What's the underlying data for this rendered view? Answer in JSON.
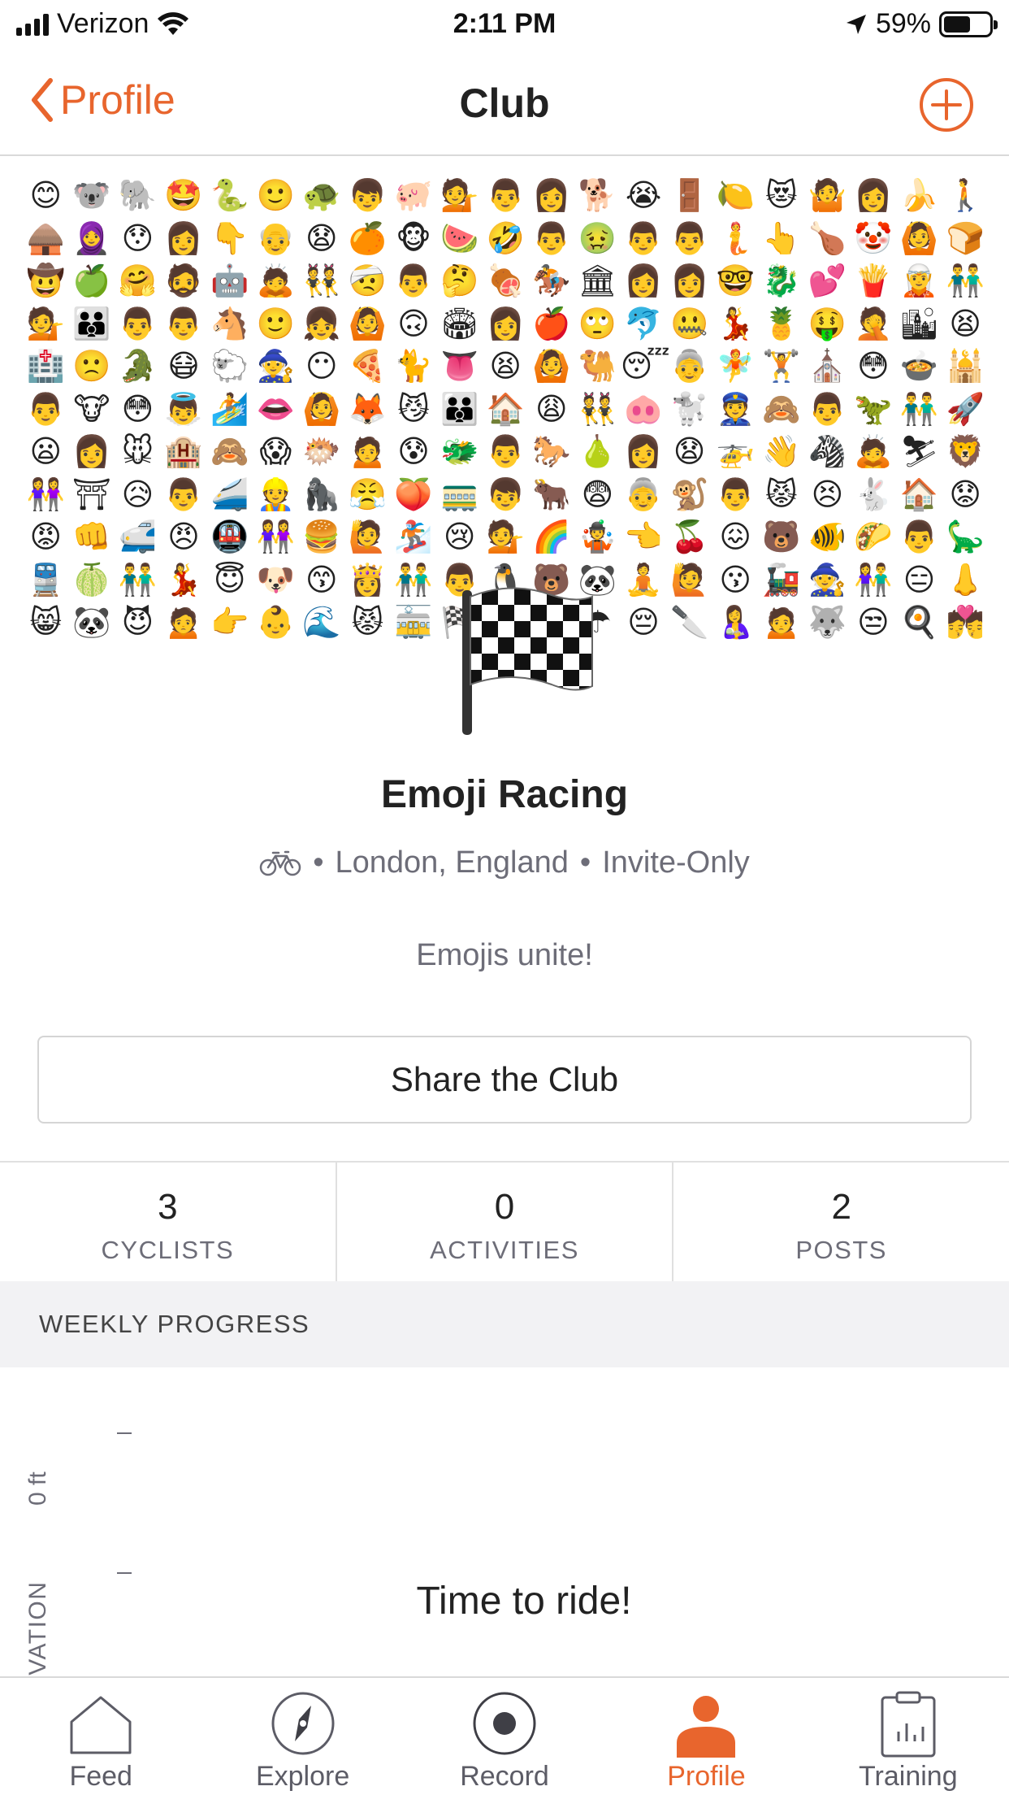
{
  "status_bar": {
    "carrier": "Verizon",
    "time": "2:11 PM",
    "battery_percent": "59%",
    "battery_level": 0.59
  },
  "nav": {
    "back_label": "Profile",
    "title": "Club",
    "add_icon": "plus-circle-icon"
  },
  "banner": {
    "emojis": [
      "😊",
      "🐨",
      "🐘",
      "🤩",
      "🐍",
      "🙂",
      "🐢",
      "👦",
      "🐖",
      "💁",
      "👨",
      "👩",
      "🐕",
      "😭",
      "🚪",
      "🍋",
      "😻",
      "🤷",
      "👩",
      "🍌",
      "🚶",
      "🛖",
      "🧕",
      "😯",
      "👩",
      "👇",
      "👴",
      "😧",
      "🍊",
      "🐵",
      "🍉",
      "🤣",
      "👨",
      "🤢",
      "👨",
      "👨",
      "🧜",
      "👆",
      "🍗",
      "🤡",
      "🙆",
      "🍞",
      "🤠",
      "🍏",
      "🤗",
      "🧔",
      "🤖",
      "🙇",
      "👯",
      "🤕",
      "👨",
      "🤔",
      "🍖",
      "🏇",
      "🏛",
      "👩",
      "👩",
      "🤓",
      "🐉",
      "💕",
      "🍟",
      "🧝",
      "👬",
      "💁",
      "👪",
      "👨",
      "👨",
      "🐴",
      "🙂",
      "👧",
      "🙆",
      "🙃",
      "🏟",
      "👩",
      "🍎",
      "🙄",
      "🐬",
      "🤐",
      "💃",
      "🍍",
      "🤑",
      "🤦",
      "🏙",
      "😫",
      "🏥",
      "🙁",
      "🐊",
      "😷",
      "🐑",
      "🧙",
      "😶",
      "🍕",
      "🐈",
      "👅",
      "😫",
      "🙆",
      "🐫",
      "😴",
      "👵",
      "🧚",
      "🏋",
      "⛪",
      "😳",
      "🍲",
      "🕌",
      "👨",
      "🐮",
      "😳",
      "👼",
      "🏄",
      "👄",
      "🙆",
      "🦊",
      "😼",
      "👪",
      "🏠",
      "😩",
      "👯",
      "🐽",
      "🐩",
      "👮",
      "🙈",
      "👨",
      "🦖",
      "👬",
      "🚀",
      "😦",
      "👩",
      "🐭",
      "🏨",
      "🙈",
      "😱",
      "🐡",
      "🙍",
      "😰",
      "🐲",
      "👨",
      "🐎",
      "🍐",
      "👩",
      "😧",
      "🚁",
      "👋",
      "🦓",
      "🙇",
      "⛷",
      "🦁",
      "👭",
      "⛩",
      "😥",
      "👨",
      "🚄",
      "👷",
      "🦍",
      "😤",
      "🍑",
      "🚃",
      "👦",
      "🐂",
      "😨",
      "👵",
      "🐒",
      "👨",
      "😾",
      "😣",
      "🐇",
      "🏠",
      "😟",
      "😡",
      "👊",
      "🚅",
      "😠",
      "🚇",
      "👭",
      "🍔",
      "🙋",
      "🏂",
      "😢",
      "💁",
      "🌈",
      "🤹",
      "👈",
      "🍒",
      "😖",
      "🐻",
      "🐠",
      "🌮",
      "👨",
      "🦕",
      "🚆",
      "🍈",
      "👬",
      "💃",
      "😇",
      "🐶",
      "😙",
      "👸",
      "👬",
      "👨",
      "🐧",
      "🐻",
      "🐼",
      "🧘",
      "🙋",
      "😗",
      "🚂",
      "🧙",
      "👫",
      "😑",
      "👃",
      "😸",
      "🐼",
      "😈",
      "🙍",
      "👉",
      "👶",
      "🌊",
      "😾",
      "🚋",
      "🏁",
      "🐝",
      "🏖",
      "☂",
      "😔",
      "🔪",
      "🤱",
      "🙍",
      "🐺",
      "😒",
      "🍳",
      "💏"
    ],
    "flag_icon": "checkered-flag-icon"
  },
  "club": {
    "name": "Emoji Racing",
    "sport_icon": "bicycle-icon",
    "separator": "•",
    "location": "London, England",
    "access": "Invite-Only",
    "description": "Emojis unite!"
  },
  "share_label": "Share the Club",
  "stats": [
    {
      "value": "3",
      "label": "CYCLISTS"
    },
    {
      "value": "0",
      "label": "ACTIVITIES"
    },
    {
      "value": "2",
      "label": "POSTS"
    }
  ],
  "weekly": {
    "header": "WEEKLY PROGRESS",
    "y_tick_label": "0 ft",
    "axis_label": "ELEVATION",
    "empty_message": "Time to ride!"
  },
  "tabs": [
    {
      "label": "Feed",
      "icon": "home-icon"
    },
    {
      "label": "Explore",
      "icon": "compass-icon"
    },
    {
      "label": "Record",
      "icon": "record-icon"
    },
    {
      "label": "Profile",
      "icon": "person-icon"
    },
    {
      "label": "Training",
      "icon": "clipboard-chart-icon"
    }
  ],
  "colors": {
    "accent": "#e8652d",
    "muted_text": "#6d6d78",
    "section_bg": "#f2f2f4"
  }
}
